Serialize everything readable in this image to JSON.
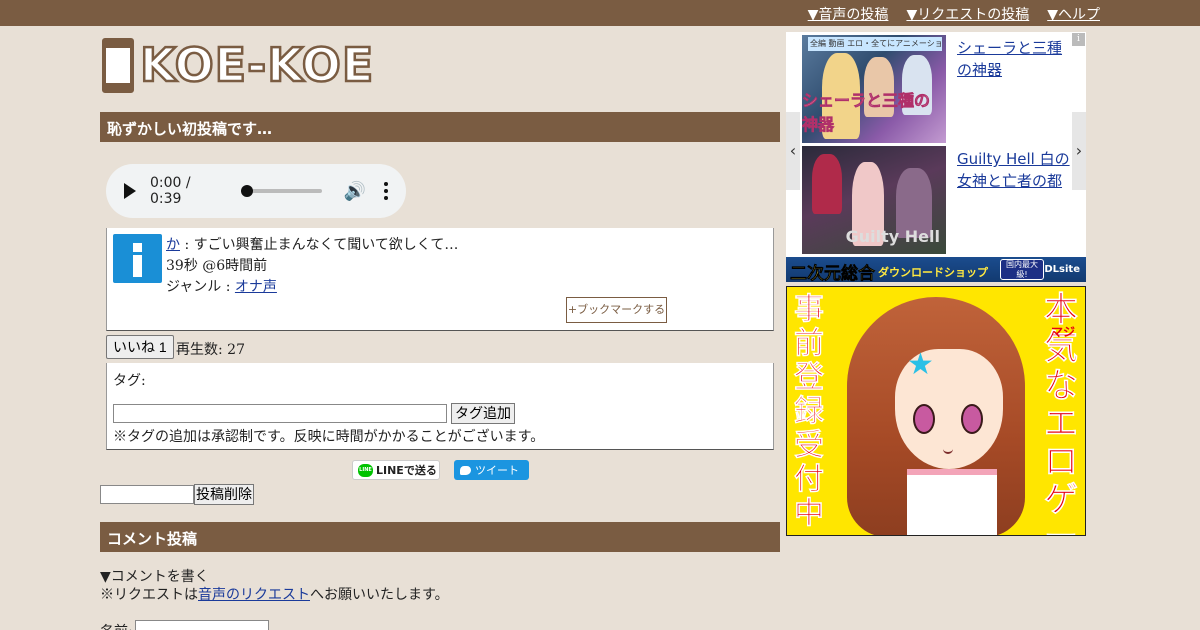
{
  "topnav": {
    "voice_post": "▼音声の投稿",
    "request_post": "▼リクエストの投稿",
    "help": "▼ヘルプ"
  },
  "logo": {
    "text": "KOE-KOE"
  },
  "post": {
    "title": "恥ずかしい初投稿です…",
    "player": {
      "current": "0:00",
      "separator": " / ",
      "duration": "0:39"
    },
    "author": "か",
    "message": " : すごい興奮止まんなくて聞いて欲しくて…",
    "meta": "39秒 @6時間前",
    "genre_label": "ジャンル : ",
    "genre": "オナ声",
    "bookmark_label": "+ブックマークする",
    "like_label": "いいね 1",
    "play_count": "再生数: 27"
  },
  "tags": {
    "label": "タグ:",
    "input_value": "",
    "add_label": "タグ追加",
    "note": "※タグの追加は承認制です。反映に時間がかかることがございます。"
  },
  "share": {
    "line_label": "LINEで送る",
    "line_icon_text": "LINE",
    "tweet_label": "ツイート"
  },
  "delete": {
    "input_value": "",
    "button_label": "投稿削除"
  },
  "comment": {
    "section_title": "コメント投稿",
    "write_label": "▼コメントを書く",
    "request_note_prefix": "※リクエストは",
    "request_link": "音声のリクエスト",
    "request_note_suffix": "へお願いいたします。",
    "name_label": "名前:"
  },
  "ads": {
    "info_icon": "i",
    "prev_arrow": "‹",
    "next_arrow": "›",
    "items": [
      {
        "title": "シェーラと三種の神器",
        "thumb_caption": "シェーラと三種の神器",
        "thumb_top": "全編 動画 エロ・全てにアニメーション導入"
      },
      {
        "title": "Guilty Hell 白の女神と亡者の都",
        "thumb_caption": "Guilty Hell"
      }
    ],
    "dl_main": "二次元総合",
    "dl_sub": "ダウンロードショップ",
    "dl_badge": "国内最大級!",
    "dl_logo": "DLsite",
    "banner_left": "事前登録受付中",
    "banner_right": "本気なエロゲー",
    "banner_right_ruby": "マジ"
  },
  "colors": {
    "brand_brown": "#7a5c42",
    "page_bg": "#e8e0d6",
    "link_blue": "#1a3a9a",
    "banner_yellow": "#ffe600",
    "banner_red": "#e60012"
  }
}
